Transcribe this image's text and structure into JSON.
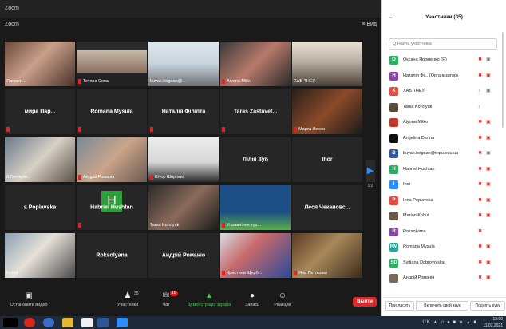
{
  "titlebar": {
    "title": "Zoom"
  },
  "viewbar": {
    "left": "Zoom",
    "right": "≡ Вид"
  },
  "tiles": [
    {
      "name": "Яромен...",
      "video": true,
      "photo": "woman-portrait",
      "muted": false
    },
    {
      "name": "Тетяна Соха",
      "video": true,
      "photo": "portrait-screen",
      "muted": true
    },
    {
      "name": "buyak.bogdan@...",
      "video": true,
      "photo": "snowy-street",
      "muted": false
    },
    {
      "name": "Alyona Milko",
      "video": true,
      "photo": "woman-room",
      "muted": true
    },
    {
      "name": "ХАБ ТНЕУ",
      "video": true,
      "photo": "lecture-hall",
      "muted": false,
      "active": true
    },
    {
      "name": "мира Пар...",
      "video": false,
      "muted": true
    },
    {
      "name": "Romana Mysula",
      "video": false,
      "muted": true
    },
    {
      "name": "Наталія Філіпта",
      "video": false,
      "muted": true
    },
    {
      "name": "Taras Zastavet...",
      "video": false,
      "muted": true
    },
    {
      "name": "Марта Лесев",
      "video": true,
      "photo": "lectern",
      "muted": true
    },
    {
      "name": "й Петльов...",
      "video": true,
      "photo": "man-portrait",
      "muted": false
    },
    {
      "name": "Андрій Романів",
      "video": true,
      "photo": "man-face",
      "muted": true
    },
    {
      "name": "Вітор Широких",
      "video": true,
      "photo": "man-suit",
      "muted": true
    },
    {
      "name": "Лілія Зуб",
      "video": false,
      "muted": false
    },
    {
      "name": "Ihor",
      "video": false,
      "muted": false
    },
    {
      "name": "a Poplavska",
      "video": false,
      "muted": false
    },
    {
      "name": "Habriel Hushtan",
      "video": false,
      "avatar": "H",
      "muted": true
    },
    {
      "name": "Taras Korolyuk",
      "video": true,
      "photo": "man-beard",
      "muted": false
    },
    {
      "name": "Управління тур...",
      "video": true,
      "photo": "logo-tile",
      "muted": true
    },
    {
      "name": "Леся Чекановс...",
      "video": false,
      "muted": false
    },
    {
      "name": "Kohut",
      "video": true,
      "photo": "man-window",
      "muted": false
    },
    {
      "name": "Roksolyana",
      "video": false,
      "muted": false
    },
    {
      "name": "Андрій Романіо",
      "video": false,
      "muted": false
    },
    {
      "name": "Кристина Щерб...",
      "video": true,
      "photo": "woman-flags",
      "muted": true
    },
    {
      "name": "Яна Петльова",
      "video": true,
      "photo": "library",
      "muted": true
    }
  ],
  "page_indicator": "1/2",
  "toolbar": {
    "buttons": [
      {
        "label": "Остановити видео",
        "icon": "video-camera-icon"
      },
      {
        "label": "Участники",
        "icon": "participants-icon",
        "count": "35"
      },
      {
        "label": "Чат",
        "icon": "chat-icon",
        "badge": "15"
      },
      {
        "label": "Демонстрація экрана",
        "icon": "share-screen-icon"
      },
      {
        "label": "Запись",
        "icon": "record-icon"
      },
      {
        "label": "Реакции",
        "icon": "reactions-icon"
      }
    ],
    "leave": "Выйти"
  },
  "panel": {
    "title": "Участники (35)",
    "search_placeholder": "Q Найти участника",
    "participants": [
      {
        "name": "Оксана Яроменко (Я)",
        "initial": "O",
        "color": "#27ae60",
        "mic": "muted",
        "cam": "on"
      },
      {
        "name": "Наталія Фі... (Организатор)",
        "initial": "H",
        "color": "#8e44ad",
        "mic": "muted",
        "cam": "off"
      },
      {
        "name": "ХАБ ТНЕУ",
        "initial": "X",
        "color": "#e74c3c",
        "mic": "on",
        "cam": "on"
      },
      {
        "name": "Taras Korolyuk",
        "initial": "",
        "color": "#5a4a3a",
        "mic": "on",
        "cam": ""
      },
      {
        "name": "Alyona Milko",
        "initial": "",
        "color": "#c0392b",
        "mic": "muted",
        "cam": "off"
      },
      {
        "name": "Angelina Derina",
        "initial": "",
        "color": "#111111",
        "mic": "muted",
        "cam": "off"
      },
      {
        "name": "buyak.bogdan@tnpu.edu.ua",
        "initial": "B",
        "color": "#2d5aa8",
        "mic": "muted",
        "cam": "on"
      },
      {
        "name": "Habriel Hushtan",
        "initial": "H",
        "color": "#27ae60",
        "mic": "muted",
        "cam": "off"
      },
      {
        "name": "Ihor",
        "initial": "I",
        "color": "#2d8cff",
        "mic": "muted",
        "cam": "off"
      },
      {
        "name": "Inna Poplavska",
        "initial": "P",
        "color": "#e74c3c",
        "mic": "muted",
        "cam": "off"
      },
      {
        "name": "Marian Kohut",
        "initial": "",
        "color": "#6b5a4a",
        "mic": "muted",
        "cam": "off"
      },
      {
        "name": "Roksolyana",
        "initial": "R",
        "color": "#8e44ad",
        "mic": "muted",
        "cam": ""
      },
      {
        "name": "Romana Mysula",
        "initial": "RM",
        "color": "#2aa89a",
        "mic": "muted",
        "cam": "off"
      },
      {
        "name": "Svitlana Dobrovolska",
        "initial": "SD",
        "color": "#27ae60",
        "mic": "muted",
        "cam": "off"
      },
      {
        "name": "Андрій Романів",
        "initial": "",
        "color": "#7a6a5a",
        "mic": "muted",
        "cam": "off"
      }
    ],
    "footer": {
      "invite": "Пригласить",
      "unmute": "Включить свой звук",
      "raise": "Поднять руку"
    }
  },
  "taskbar": {
    "time": "13:00",
    "date": "11.02.2021",
    "lang": "UK"
  },
  "colors": {
    "accent": "#2d8cff",
    "danger": "#d92b2b",
    "active_speaker": "#8cd94a",
    "share_green": "#42c24a"
  }
}
